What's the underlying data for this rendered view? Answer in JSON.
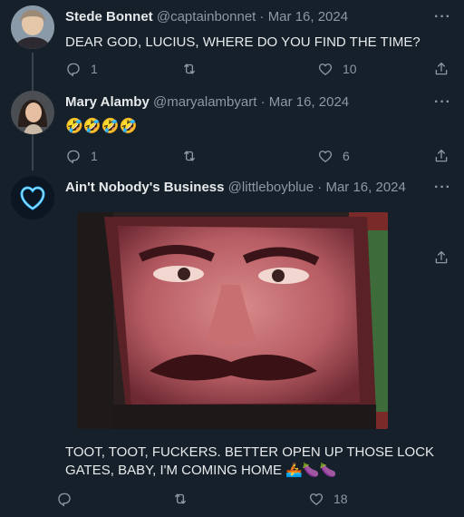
{
  "tweets": [
    {
      "name": "Stede Bonnet",
      "handle": "@captainbonnet",
      "date": "Mar 16, 2024",
      "text": "DEAR GOD, LUCIUS, WHERE DO YOU FIND THE TIME?",
      "replies": "1",
      "retweets": "",
      "likes": "10"
    },
    {
      "name": "Mary Alamby",
      "handle": "@maryalambyart",
      "date": "Mar 16, 2024",
      "text": "🤣🤣🤣🤣",
      "replies": "1",
      "retweets": "",
      "likes": "6"
    },
    {
      "name": "Ain't Nobody's Business",
      "handle": "@littleboyblue",
      "date": "Mar 16, 2024",
      "text_line1": "TOOT, TOOT, FUCKERS. BETTER OPEN UP THOSE LOCK",
      "text_line2": "GATES, BABY, I'M COMING HOME 🚣🍆🍆",
      "replies": "",
      "retweets": "",
      "likes": "18"
    }
  ],
  "separator": "·",
  "more_label": "···",
  "icons": {
    "reply": "reply-icon",
    "retweet": "retweet-icon",
    "like": "like-icon",
    "share": "share-icon",
    "more": "more-icon"
  },
  "colors": {
    "background": "#15202b",
    "text": "#e7e9ea",
    "muted": "#8b98a5",
    "thread_line": "#38444d",
    "heart_avatar": "#29b6ff"
  }
}
